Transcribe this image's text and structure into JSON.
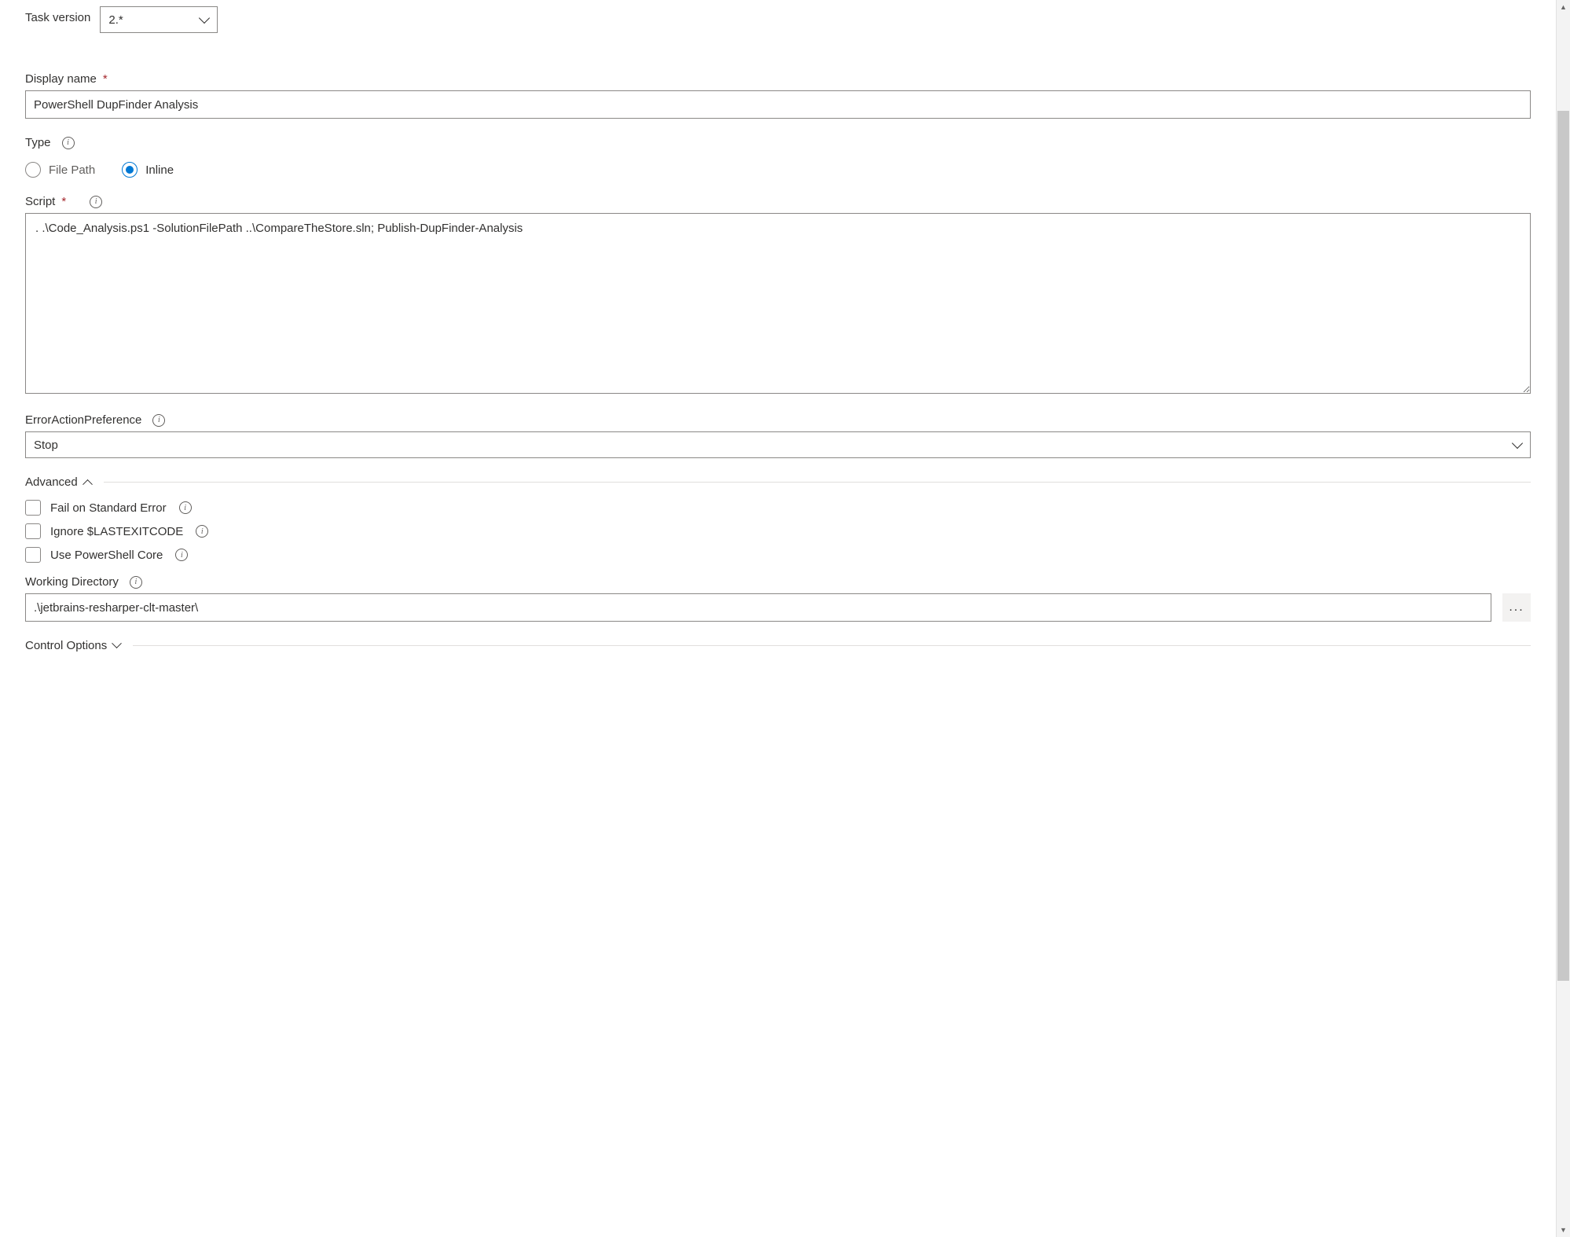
{
  "task_version": {
    "label": "Task version",
    "value": "2.*"
  },
  "display_name": {
    "label": "Display name",
    "value": "PowerShell DupFinder Analysis"
  },
  "type": {
    "label": "Type",
    "options": {
      "file_path": "File Path",
      "inline": "Inline"
    },
    "selected": "inline"
  },
  "script": {
    "label": "Script",
    "value": ". .\\Code_Analysis.ps1 -SolutionFilePath ..\\CompareTheStore.sln; Publish-DupFinder-Analysis"
  },
  "error_action": {
    "label": "ErrorActionPreference",
    "value": "Stop"
  },
  "advanced": {
    "label": "Advanced",
    "fail_on_stderr": "Fail on Standard Error",
    "ignore_lastexitcode": "Ignore $LASTEXITCODE",
    "use_pwsh_core": "Use PowerShell Core",
    "working_dir": {
      "label": "Working Directory",
      "value": ".\\jetbrains-resharper-clt-master\\"
    }
  },
  "control_options": {
    "label": "Control Options"
  },
  "browse_label": "..."
}
